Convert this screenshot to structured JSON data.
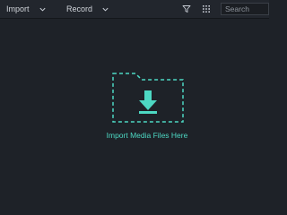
{
  "toolbar": {
    "import_label": "Import",
    "record_label": "Record",
    "search_placeholder": "Search"
  },
  "icons": {
    "import_chevron": "chevron-down-icon",
    "record_chevron": "chevron-down-icon",
    "filter": "filter-icon",
    "grid": "grid-view-icon",
    "folder": "folder-download-icon"
  },
  "colors": {
    "background": "#1e2228",
    "toolbar": "#22262d",
    "accent": "#4dd8c3",
    "text": "#d0d4da"
  },
  "media_area": {
    "empty_label": "Import Media Files Here"
  }
}
